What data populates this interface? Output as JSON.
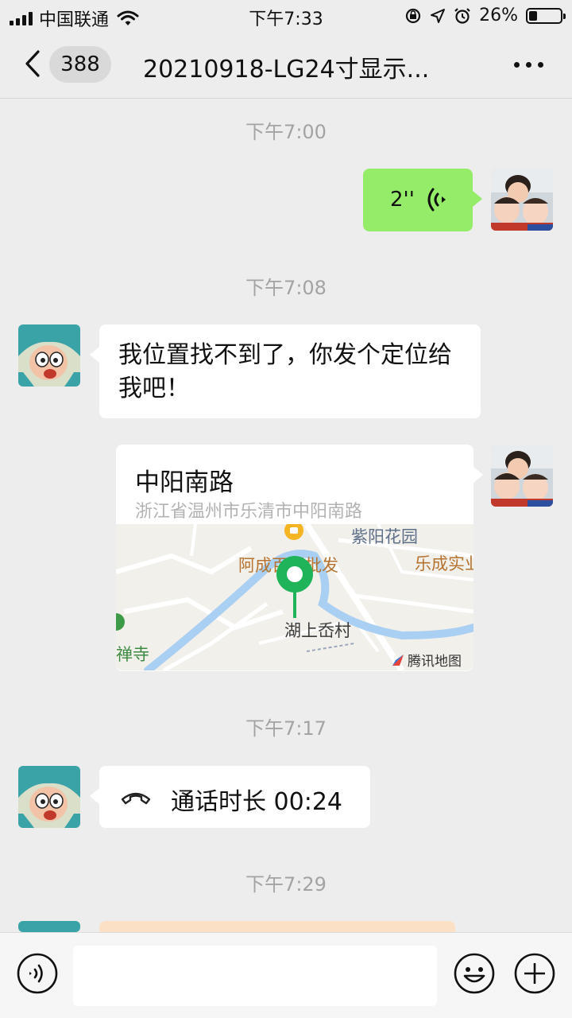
{
  "status_bar": {
    "carrier": "中国联通",
    "time": "下午7:33",
    "battery_text": "26%",
    "battery_level": 0.26
  },
  "nav": {
    "unread_count": "388",
    "title": "20210918-LG24寸显示..."
  },
  "messages": [
    {
      "type": "timestamp",
      "text": "下午7:00"
    },
    {
      "type": "voice",
      "sender": "self",
      "duration": "2''"
    },
    {
      "type": "timestamp",
      "text": "下午7:08"
    },
    {
      "type": "text",
      "sender": "other",
      "text": "我位置找不到了，你发个定位给我吧！"
    },
    {
      "type": "location",
      "sender": "self",
      "title": "中阳南路",
      "address": "浙江省温州市乐清市中阳南路",
      "map_labels": {
        "park": "紫阳花园",
        "shop": "阿成百货批发",
        "company": "乐成实业",
        "temple": "禅寺",
        "village": "湖上岙村",
        "provider": "腾讯地图"
      }
    },
    {
      "type": "timestamp",
      "text": "下午7:17"
    },
    {
      "type": "call",
      "sender": "other",
      "text": "通话时长 00:24"
    },
    {
      "type": "timestamp",
      "text": "下午7:29"
    }
  ],
  "colors": {
    "self_bubble": "#95ec69",
    "other_bubble": "#ffffff",
    "background": "#ededed",
    "map_pin": "#1fb45a"
  }
}
